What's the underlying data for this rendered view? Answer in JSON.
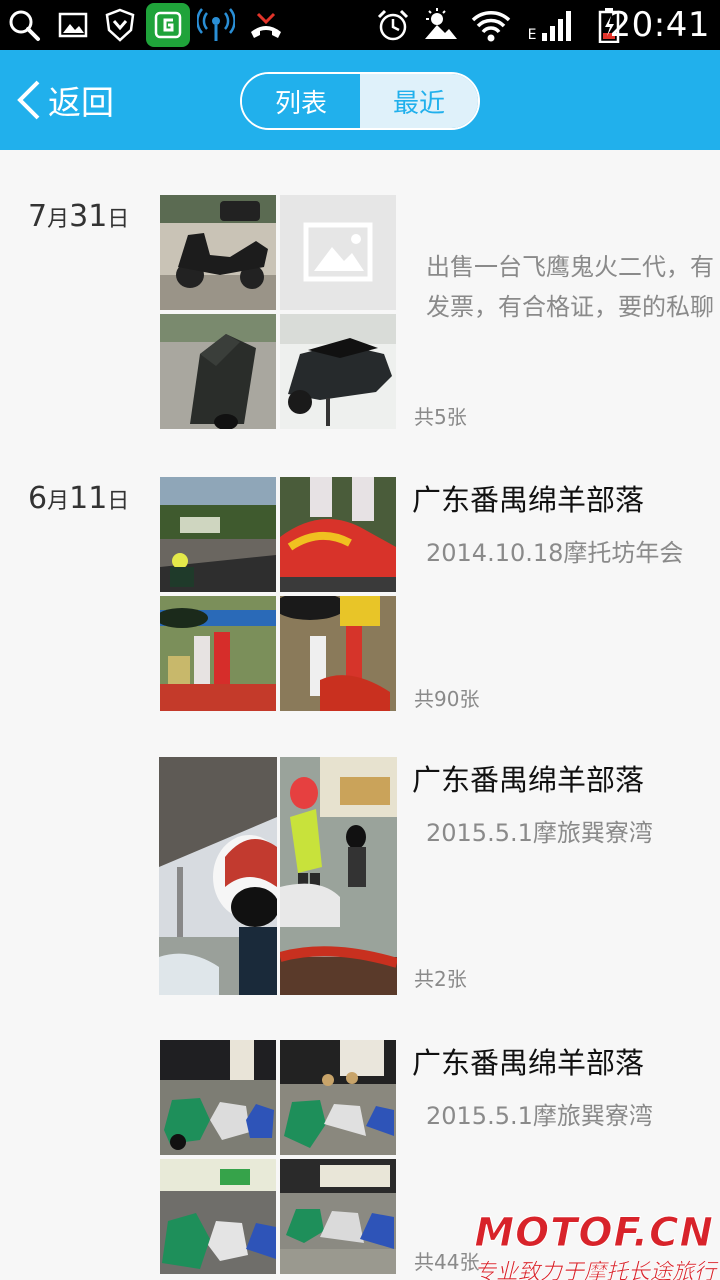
{
  "status_bar": {
    "time": "20:41",
    "left_icons": [
      "search-icon",
      "gallery-icon",
      "shield-icon",
      "app-badge-icon",
      "wifi-signal-icon",
      "missed-call-icon"
    ],
    "right_icons": [
      "alarm-icon",
      "weather-icon",
      "wifi-icon",
      "cellular-icon",
      "battery-icon"
    ],
    "network_type": "E"
  },
  "header": {
    "back_label": "返回",
    "tabs": [
      {
        "label": "列表",
        "active": false
      },
      {
        "label": "最近",
        "active": true
      }
    ],
    "accent_color": "#21b0ec"
  },
  "posts": [
    {
      "date_month": "7",
      "date_day": "31",
      "month_char": "月",
      "day_char": "日",
      "title": "",
      "subtitle": "",
      "description": "出售一台飞鹰鬼火二代，有发票，有合格证，要的私聊",
      "count_label": "共5张"
    },
    {
      "date_month": "6",
      "date_day": "11",
      "month_char": "月",
      "day_char": "日",
      "title": "广东番禺绵羊部落",
      "subtitle": "2014.10.18摩托坊年会",
      "description": "",
      "count_label": "共90张"
    },
    {
      "title": "广东番禺绵羊部落",
      "subtitle": "2015.5.1摩旅巽寮湾",
      "description": "",
      "count_label": "共2张"
    },
    {
      "title": "广东番禺绵羊部落",
      "subtitle": "2015.5.1摩旅巽寮湾",
      "description": "",
      "count_label": "共44张"
    }
  ],
  "watermark": {
    "brand": "MOTOF.CN",
    "slogan": "专业致力于摩托长途旅行"
  }
}
